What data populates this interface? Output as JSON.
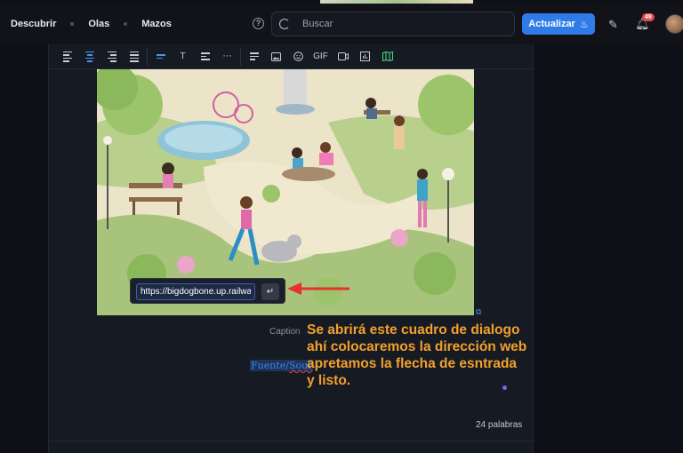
{
  "header": {
    "nav": [
      "Descubrir",
      "Olas",
      "Mazos"
    ],
    "search_placeholder": "Buscar",
    "update_label": "Actualizar",
    "notification_count": "49"
  },
  "toolbar": {
    "buttons": [
      {
        "name": "align-left-icon",
        "label": ""
      },
      {
        "name": "align-center-icon",
        "label": ""
      },
      {
        "name": "align-right-icon",
        "label": ""
      },
      {
        "name": "align-justify-icon",
        "label": ""
      },
      {
        "name": "text-style-icon",
        "label": ""
      },
      {
        "name": "text-size-icon",
        "label": "T"
      },
      {
        "name": "list-icon",
        "label": ""
      },
      {
        "name": "more-icon",
        "label": "⋯"
      },
      {
        "name": "paragraph-icon",
        "label": ""
      },
      {
        "name": "image-icon",
        "label": ""
      },
      {
        "name": "emoji-icon",
        "label": ""
      },
      {
        "name": "gif-button",
        "label": "GIF"
      },
      {
        "name": "video-icon",
        "label": ""
      },
      {
        "name": "chart-icon",
        "label": ""
      },
      {
        "name": "map-icon",
        "label": ""
      }
    ]
  },
  "link_dialog": {
    "url_value": "https://bigdogbone.up.railway.app",
    "enter_symbol": "↵"
  },
  "editor": {
    "caption_placeholder": "Caption",
    "source_prefix": "Fuente/",
    "source_underlined": "Sour",
    "word_count": "24 palabras"
  },
  "annotation": {
    "lines": [
      "Se abrirá este cuadro de dialogo",
      "ahí colocaremos la dirección web",
      "apretamos la flecha de esntrada",
      "y listo."
    ],
    "color": "#f3a02c"
  },
  "colors": {
    "accent": "#2f7be8",
    "background": "#0d1117",
    "panel": "#161a22"
  }
}
